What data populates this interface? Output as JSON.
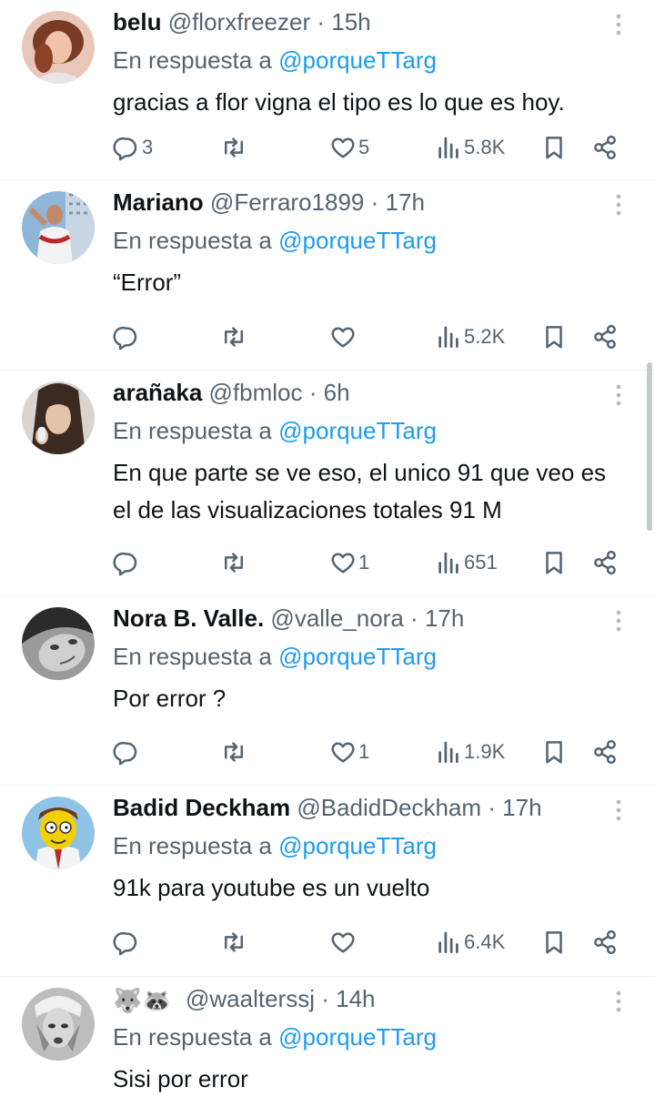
{
  "replies": [
    {
      "name": "belu",
      "handle": "@florxfreezer",
      "separator": "·",
      "time": "15h",
      "reply_prefix": "En respuesta a",
      "reply_to": "@porqueTTarg",
      "lines": [
        "gracias a flor vigna el tipo es lo que es hoy."
      ],
      "replies_count": "3",
      "retweets_count": "",
      "likes_count": "5",
      "views_count": "5.8K"
    },
    {
      "name": "Mariano",
      "handle": "@Ferraro1899",
      "separator": "·",
      "time": "17h",
      "reply_prefix": "En respuesta a",
      "reply_to": "@porqueTTarg",
      "lines": [
        "“Error”"
      ],
      "replies_count": "",
      "retweets_count": "",
      "likes_count": "",
      "views_count": "5.2K"
    },
    {
      "name": "arañaka",
      "handle": "@fbmloc",
      "separator": "·",
      "time": "6h",
      "reply_prefix": "En respuesta a",
      "reply_to": "@porqueTTarg",
      "lines": [
        "En que parte se ve eso, el unico 91 que veo es",
        "el de las visualizaciones totales 91 M"
      ],
      "replies_count": "",
      "retweets_count": "",
      "likes_count": "1",
      "views_count": "651"
    },
    {
      "name": "Nora B. Valle.",
      "handle": "@valle_nora",
      "separator": "·",
      "time": "17h",
      "reply_prefix": "En respuesta a",
      "reply_to": "@porqueTTarg",
      "lines": [
        "Por error ?"
      ],
      "replies_count": "",
      "retweets_count": "",
      "likes_count": "1",
      "views_count": "1.9K"
    },
    {
      "name": "Badid Deckham",
      "handle": "@BadidDeckham",
      "separator": "·",
      "time": "17h",
      "reply_prefix": "En respuesta a",
      "reply_to": "@porqueTTarg",
      "lines": [
        "91k para youtube es un vuelto"
      ],
      "replies_count": "",
      "retweets_count": "",
      "likes_count": "",
      "views_count": "6.4K"
    },
    {
      "name": "🐺🦝",
      "handle": "@waalterssj",
      "separator": "·",
      "time": "14h",
      "reply_prefix": "En respuesta a",
      "reply_to": "@porqueTTarg",
      "lines": [
        "Sisi por error"
      ],
      "replies_count": "",
      "retweets_count": "",
      "likes_count": "",
      "views_count": ""
    }
  ],
  "icons": {
    "reply": "reply-icon",
    "retweet": "retweet-icon",
    "like": "heart-icon",
    "views": "views-icon",
    "bookmark": "bookmark-icon",
    "share": "share-icon",
    "more": "more-icon"
  },
  "colors": {
    "text": "#0f1419",
    "muted": "#536471",
    "link": "#1d9bf0",
    "divider": "#eff3f4"
  }
}
